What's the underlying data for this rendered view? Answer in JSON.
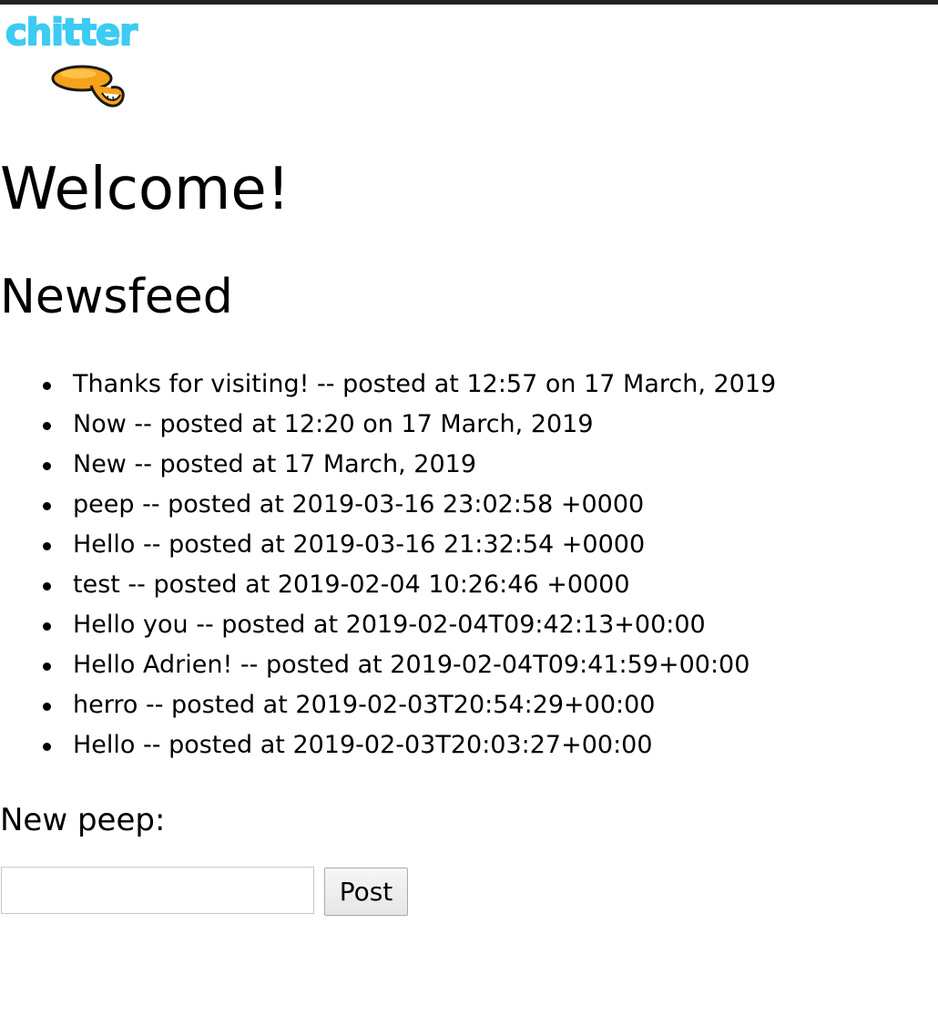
{
  "logo": {
    "text": "chitter",
    "icon": "chitter-bird-logo",
    "text_color": "#3ccbf2",
    "bird_color": "#f7a21b"
  },
  "header": {
    "welcome": "Welcome!",
    "section_title": "Newsfeed"
  },
  "feed": {
    "items": [
      "Thanks for visiting! -- posted at 12:57 on 17 March, 2019",
      "Now -- posted at 12:20 on 17 March, 2019",
      "New -- posted at 17 March, 2019",
      "peep -- posted at 2019-03-16 23:02:58 +0000",
      "Hello -- posted at 2019-03-16 21:32:54 +0000",
      "test -- posted at 2019-02-04 10:26:46 +0000",
      "Hello you -- posted at 2019-02-04T09:42:13+00:00",
      "Hello Adrien! -- posted at 2019-02-04T09:41:59+00:00",
      "herro -- posted at 2019-02-03T20:54:29+00:00",
      "Hello -- posted at 2019-02-03T20:03:27+00:00"
    ]
  },
  "form": {
    "label": "New peep:",
    "input_value": "",
    "input_placeholder": "",
    "post_button": "Post"
  }
}
